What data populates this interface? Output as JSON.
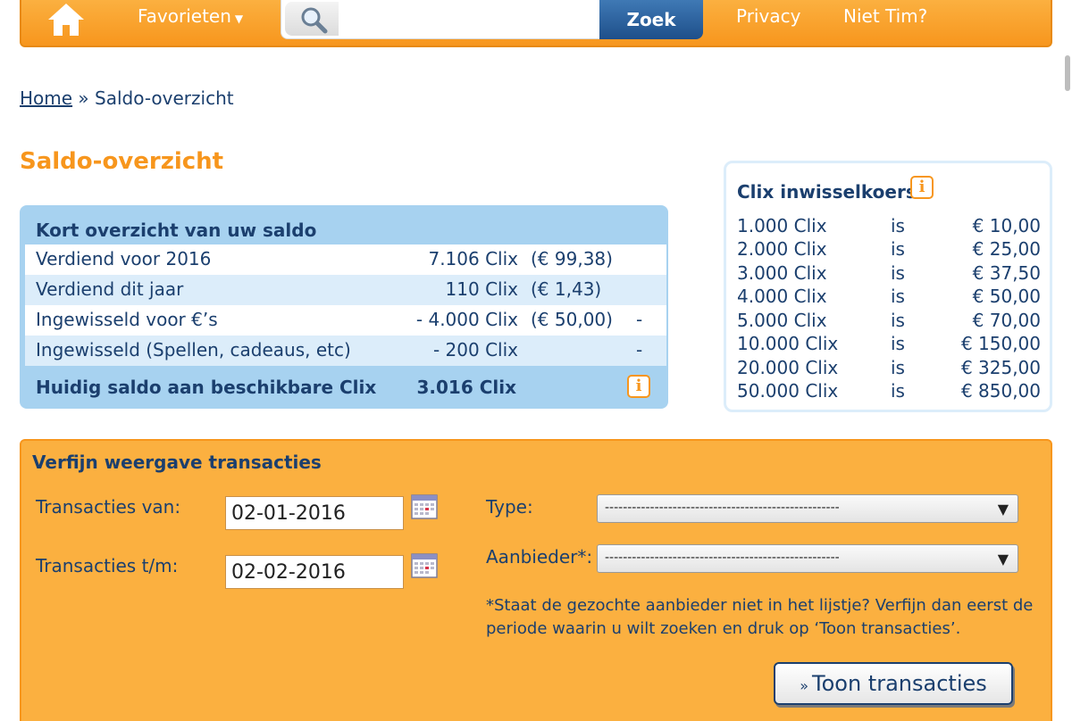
{
  "nav": {
    "favorites": "Favorieten",
    "search_placeholder": "",
    "search_button": "Zoek",
    "privacy": "Privacy",
    "not_user": "Niet Tim?"
  },
  "breadcrumb": {
    "home": "Home",
    "separator": "»",
    "current": "Saldo-overzicht"
  },
  "page_title": "Saldo-overzicht",
  "saldo": {
    "heading": "Kort overzicht van uw saldo",
    "rows": [
      {
        "label": "Verdiend voor 2016",
        "clix": "7.106 Clix",
        "euro": "(€ 99,38)",
        "dash": ""
      },
      {
        "label": "Verdiend dit jaar",
        "clix": "110 Clix",
        "euro": "(€ 1,43)",
        "dash": ""
      },
      {
        "label": "Ingewisseld voor €’s",
        "clix": "- 4.000 Clix",
        "euro": "(€ 50,00)",
        "dash": "-"
      },
      {
        "label": "Ingewisseld (Spellen, cadeaus, etc)",
        "clix": "- 200 Clix",
        "euro": "",
        "dash": "-"
      }
    ],
    "total_label": "Huidig saldo aan beschikbare Clix",
    "total_value": "3.016 Clix"
  },
  "koers": {
    "title": "Clix inwisselkoers",
    "rows": [
      {
        "amount": "1.000 Clix",
        "is": "is",
        "value": "€ 10,00"
      },
      {
        "amount": "2.000 Clix",
        "is": "is",
        "value": "€ 25,00"
      },
      {
        "amount": "3.000 Clix",
        "is": "is",
        "value": "€ 37,50"
      },
      {
        "amount": "4.000 Clix",
        "is": "is",
        "value": "€ 50,00"
      },
      {
        "amount": "5.000 Clix",
        "is": "is",
        "value": "€ 70,00"
      },
      {
        "amount": "10.000 Clix",
        "is": "is",
        "value": "€ 150,00"
      },
      {
        "amount": "20.000 Clix",
        "is": "is",
        "value": "€ 325,00"
      },
      {
        "amount": "50.000 Clix",
        "is": "is",
        "value": "€ 850,00"
      }
    ]
  },
  "filter": {
    "title": "Verfijn weergave transacties",
    "from_label": "Transacties van:",
    "from_value": "02-01-2016",
    "to_label": "Transacties t/m:",
    "to_value": "02-02-2016",
    "type_label": "Type:",
    "type_value": "----------------------------------------------------",
    "provider_label": "Aanbieder*:",
    "provider_value": "----------------------------------------------------",
    "note": "*Staat de gezochte aanbieder niet in het lijstje? Verfijn dan eerst de periode waarin u wilt zoeken en druk op ‘Toon transacties’.",
    "submit_label": "Toon transacties",
    "submit_prefix": "»"
  },
  "icons": {
    "home": "home-icon",
    "search": "search-icon",
    "info": "info-icon",
    "calendar": "calendar-icon",
    "dropdown": "chevron-down-icon"
  },
  "colors": {
    "accent_orange": "#f7961d",
    "brand_blue": "#1b3f6e",
    "panel_blue": "#a7d2f0",
    "filter_bg": "#fbb040"
  }
}
